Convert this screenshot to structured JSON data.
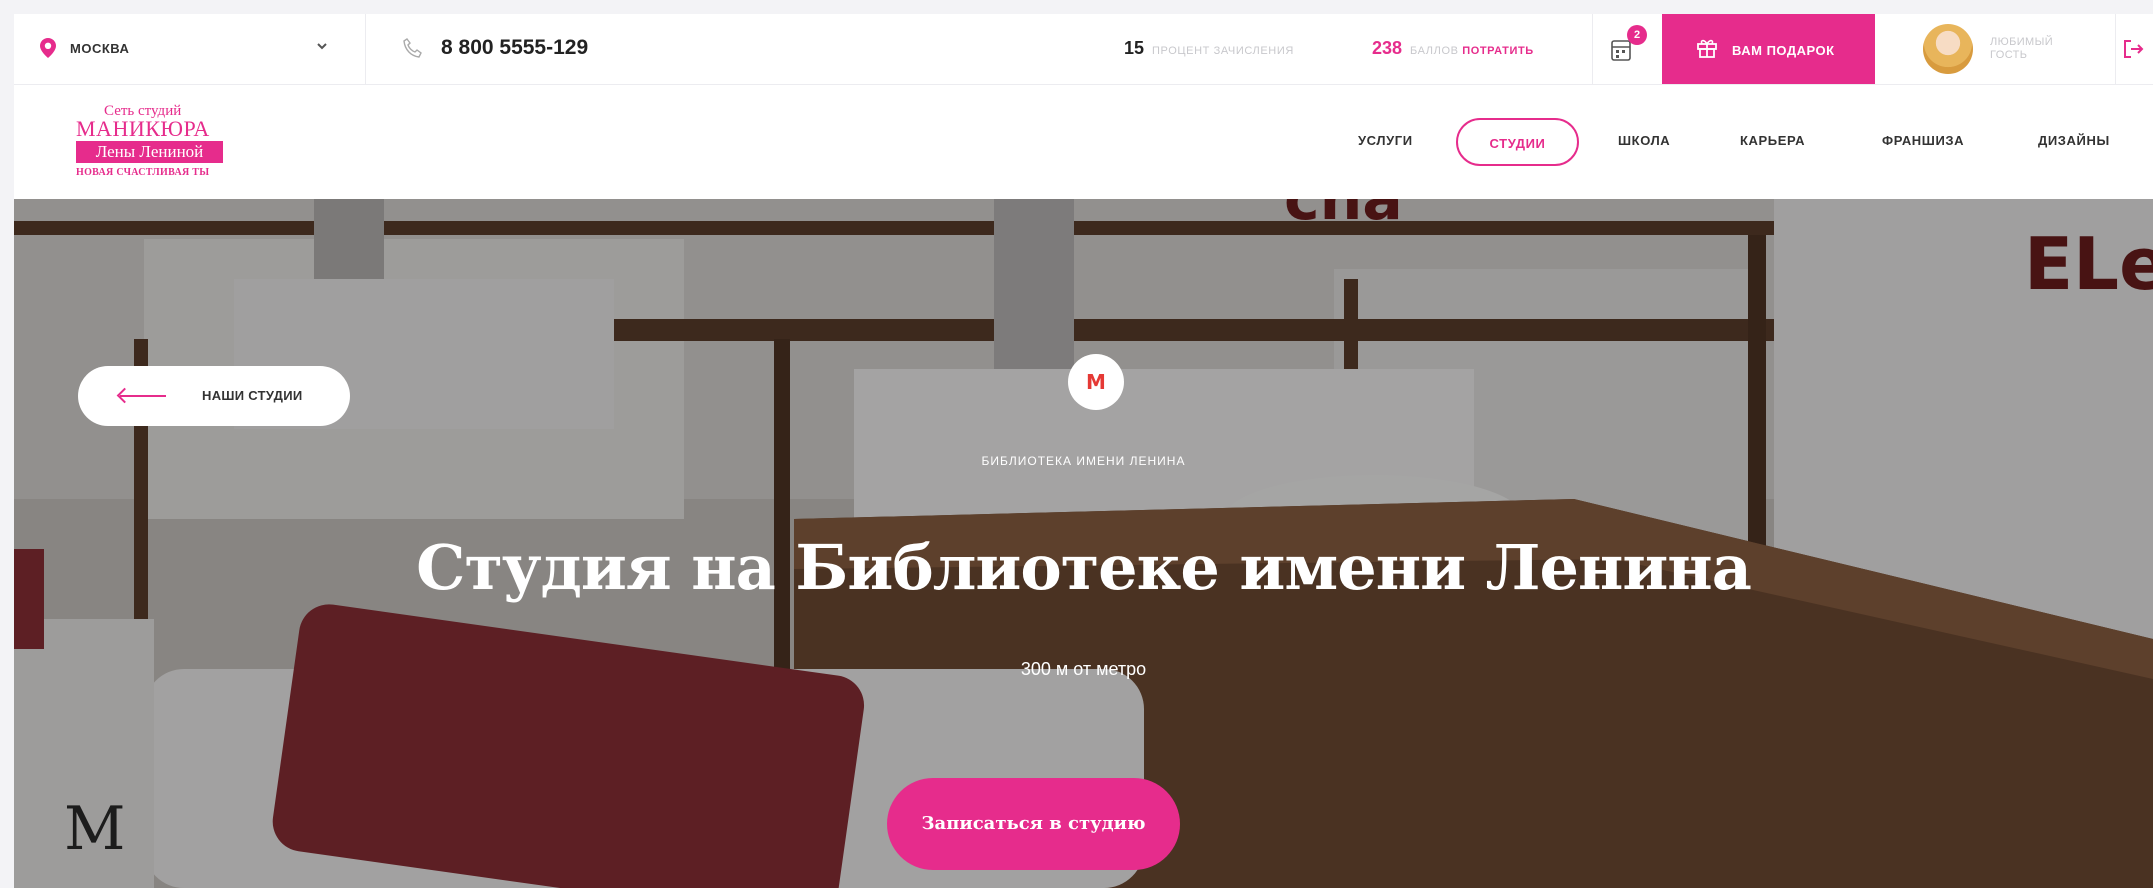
{
  "topbar": {
    "city": "МОСКВА",
    "phone": "8 800 5555-129",
    "percent_value": "15",
    "percent_label": "ПРОЦЕНТ ЗАЧИСЛЕНИЯ",
    "points_value": "238",
    "points_label": "БАЛЛОВ",
    "points_action": "ПОТРАТИТЬ",
    "calendar_badge": "2",
    "gift_label": "ВАМ ПОДАРОК",
    "user_label": "ЛЮБИМЫЙ ГОСТЬ"
  },
  "logo": {
    "line1": "Сеть студий",
    "line2": "МАНИКЮРА",
    "line3": "Лены Лениной",
    "tagline": "НОВАЯ СЧАСТЛИВАЯ ТЫ"
  },
  "nav": {
    "items": [
      "УСЛУГИ",
      "СТУДИИ",
      "ШКОЛА",
      "КАРЬЕРА",
      "ФРАНШИЗА",
      "ДИЗАЙНЫ"
    ],
    "active": "СТУДИИ"
  },
  "hero": {
    "back_label": "НАШИ СТУДИИ",
    "metro_symbol": "M",
    "metro_station": "БИБЛИОТЕКА ИМЕНИ ЛЕНИНА",
    "title": "Студия на Библиотеке имени Ленина",
    "distance": "300 м от метро",
    "cta_label": "Записаться в студию"
  },
  "colors": {
    "accent": "#e62c8c",
    "metro": "#e53935"
  }
}
